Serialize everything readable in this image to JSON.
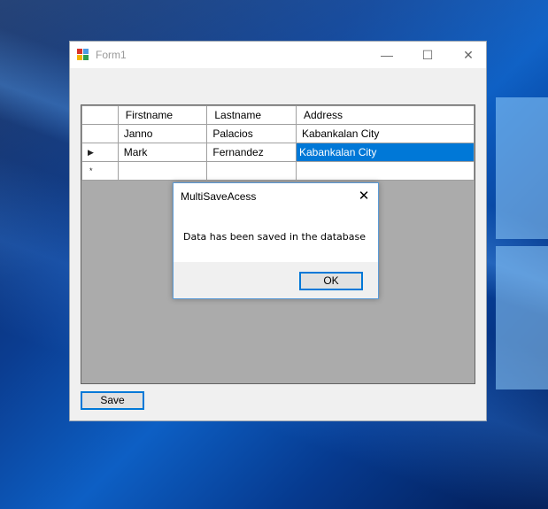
{
  "window": {
    "title": "Form1",
    "minimize_glyph": "—",
    "maximize_glyph": "☐",
    "close_glyph": "✕"
  },
  "grid": {
    "columns": [
      "Firstname",
      "Lastname",
      "Address"
    ],
    "rows": [
      {
        "indicator": "",
        "cells": [
          "Janno",
          "Palacios",
          "Kabankalan City"
        ]
      },
      {
        "indicator": "▶",
        "cells": [
          "Mark",
          "Fernandez",
          "Kabankalan City"
        ]
      },
      {
        "indicator": "*",
        "cells": [
          "",
          "",
          ""
        ]
      }
    ],
    "selected_cell": "Kabankalan City"
  },
  "save_button": {
    "label": "Save"
  },
  "message_box": {
    "title": "MultiSaveAcess",
    "message": "Data has been saved in the database",
    "ok_label": "OK",
    "close_glyph": "✕"
  },
  "colors": {
    "selection": "#0078d7",
    "grid_background": "#ababab",
    "form_background": "#f0f0f0"
  }
}
